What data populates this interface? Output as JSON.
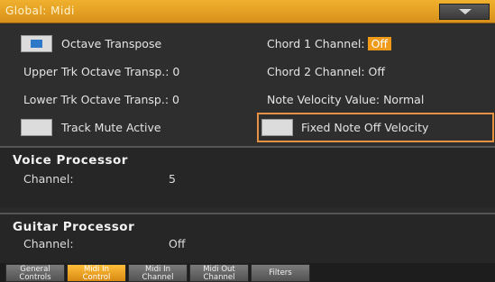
{
  "window": {
    "title": "Global: Midi"
  },
  "top": {
    "octave_transpose": {
      "label": "Octave Transpose",
      "checked": true
    },
    "upper_trk": "Upper Trk Octave Transp.: 0",
    "lower_trk": "Lower Trk Octave Transp.: 0",
    "track_mute": {
      "label": "Track Mute Active",
      "checked": false
    },
    "chord1": {
      "label": "Chord 1 Channel:",
      "value": "Off"
    },
    "chord2": "Chord 2 Channel: Off",
    "note_velocity": "Note Velocity Value: Normal",
    "fixed_note_off": {
      "label": "Fixed Note Off Velocity",
      "checked": false
    }
  },
  "voice_processor": {
    "heading": "Voice Processor",
    "channel_label": "Channel:",
    "channel_value": "5"
  },
  "guitar_processor": {
    "heading": "Guitar Processor",
    "channel_label": "Channel:",
    "channel_value": "Off"
  },
  "tabs": [
    {
      "line1": "General",
      "line2": "Controls",
      "active": false
    },
    {
      "line1": "Midi In",
      "line2": "Control",
      "active": true
    },
    {
      "line1": "Midi In",
      "line2": "Channel",
      "active": false
    },
    {
      "line1": "Midi Out",
      "line2": "Channel",
      "active": false
    },
    {
      "line1": "Filters",
      "line2": "",
      "active": false
    }
  ],
  "colors": {
    "accent": "#f0a020",
    "focus": "#e69243",
    "checkbox_fill": "#2f78c8"
  }
}
